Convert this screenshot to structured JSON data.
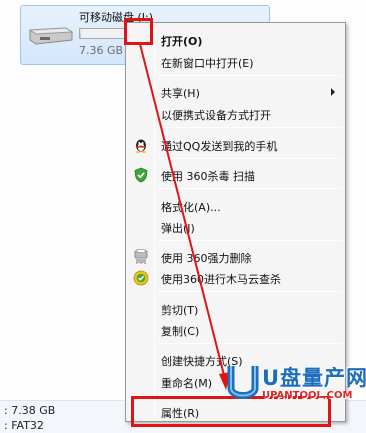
{
  "drive": {
    "name": "可移动磁盘 (I:)",
    "size": "7.36 GB",
    "used_fraction": 0.02
  },
  "details": {
    "size": ": 7.38 GB",
    "filesystem": ": FAT32"
  },
  "menu": {
    "items": [
      {
        "label": "打开(O)",
        "bold": true
      },
      {
        "label": "在新窗口中打开(E)"
      },
      {
        "label": "共享(H)",
        "submenu": true
      },
      {
        "label": "以便携式设备方式打开"
      },
      {
        "label": "通过QQ发送到我的手机",
        "icon": "qq-penguin-icon"
      },
      {
        "label": "使用 360杀毒 扫描",
        "icon": "360-shield-icon"
      },
      {
        "label": "格式化(A)..."
      },
      {
        "label": "弹出(J)"
      },
      {
        "label": "使用 360强力删除",
        "icon": "shredder-icon"
      },
      {
        "label": "使用360进行木马云查杀",
        "icon": "360-scan-icon"
      },
      {
        "label": "剪切(T)"
      },
      {
        "label": "复制(C)"
      },
      {
        "label": "创建快捷方式(S)"
      },
      {
        "label": "重命名(M)"
      },
      {
        "label": "属性(R)"
      }
    ]
  },
  "annotation": {
    "color": "#e01414"
  },
  "watermark": {
    "text_cn": "U盘量产网",
    "text_en": "UPANTOOL.COM"
  }
}
